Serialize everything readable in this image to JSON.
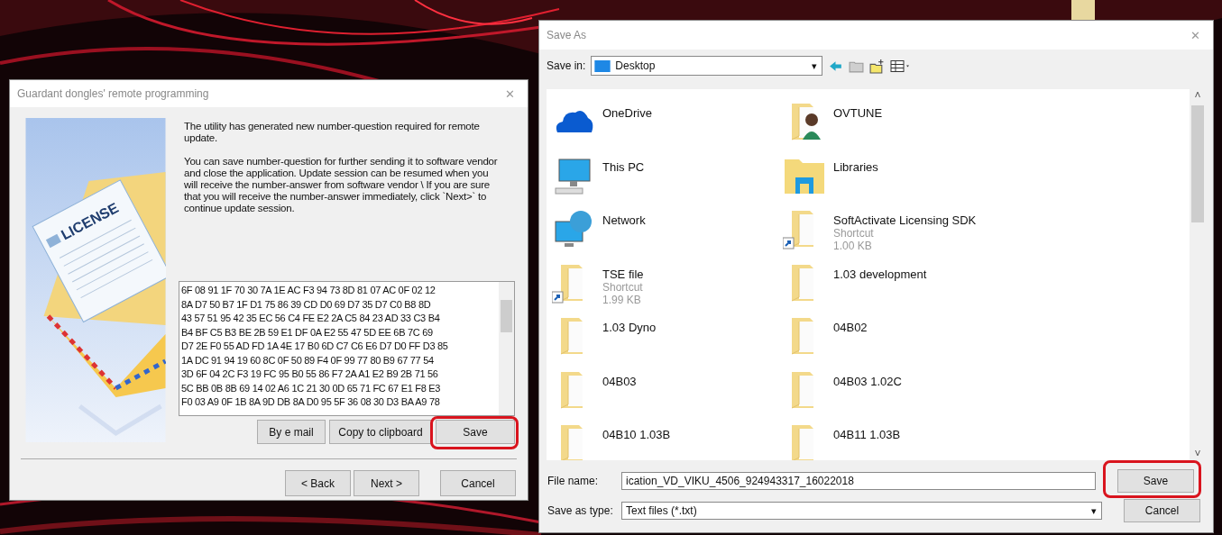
{
  "wizard": {
    "title": "Guardant dongles' remote programming",
    "close": "✕",
    "illustration_text": "LICENSE",
    "paragraphs": [
      "The utility has generated new number-question required for remote update.",
      " You can save number-question for further sending it to software vendor and close the application. Update session can be resumed when you will receive the number-answer from software vendor \\ If you are sure that you will receive the number-answer immediately, click `Next>` to continue update session."
    ],
    "hex_lines": [
      "6F 08 91 1F 70 30 7A 1E AC F3 94 73 8D 81 07 AC 0F 02 12",
      "8A D7 50 B7 1F D1 75 86 39 CD D0 69 D7 35 D7 C0 B8 8D",
      "43 57 51 95 42 35 EC 56 C4 FE E2 2A C5 84 23 AD 33 C3 B4",
      "B4 BF C5 B3 BE 2B 59 E1 DF 0A E2 55 47 5D EE 6B 7C 69",
      "D7 2E F0 55 AD FD 1A 4E 17 B0 6D C7 C6 E6 D7 D0 FF D3 85",
      "1A DC 91 94 19 60 8C 0F 50 89 F4 0F 99 77 80 B9 67 77 54",
      "3D 6F 04 2C F3 19 FC 95 B0 55 86 F7 2A A1 E2 B9 2B 71 56",
      "5C BB 0B 8B 69 14 02 A6 1C 21 30 0D 65 71 FC 67 E1 F8 E3",
      "F0 03 A9 0F 1B 8A 9D DB 8A D0 95 5F 36 08 30 D3 BA A9 78"
    ],
    "actions": [
      {
        "label": "By e mail",
        "highlighted": false
      },
      {
        "label": "Copy to clipboard",
        "highlighted": false
      },
      {
        "label": "Save",
        "highlighted": true
      }
    ],
    "nav": [
      {
        "label": "< Back"
      },
      {
        "label": "Next >"
      },
      {
        "label": "Cancel"
      }
    ]
  },
  "save_as": {
    "title": "Save As",
    "close": "✕",
    "save_in_label": "Save in:",
    "save_in_value": "Desktop",
    "dropdown_arrow": "▾",
    "scroll_up": "˄",
    "scroll_down": "˅",
    "items": [
      {
        "name": "OneDrive",
        "kind": "cloud",
        "shortcut": false
      },
      {
        "name": "OVTUNE",
        "kind": "user-folder",
        "shortcut": false
      },
      {
        "name": "This PC",
        "kind": "computer",
        "shortcut": false
      },
      {
        "name": "Libraries",
        "kind": "library",
        "shortcut": false
      },
      {
        "name": "Network",
        "kind": "network",
        "shortcut": false
      },
      {
        "name": "SoftActivate Licensing SDK",
        "kind": "folder",
        "shortcut": true,
        "details": [
          "Shortcut",
          "1.00 KB"
        ]
      },
      {
        "name": "TSE file",
        "kind": "folder",
        "shortcut": true,
        "details": [
          "Shortcut",
          "1.99 KB"
        ]
      },
      {
        "name": "1.03 development",
        "kind": "folder",
        "shortcut": false
      },
      {
        "name": "1.03 Dyno",
        "kind": "folder",
        "shortcut": false
      },
      {
        "name": "04B02",
        "kind": "folder",
        "shortcut": false
      },
      {
        "name": "04B03",
        "kind": "folder",
        "shortcut": false
      },
      {
        "name": "04B03 1.02C",
        "kind": "folder",
        "shortcut": false
      },
      {
        "name": "04B10 1.03B",
        "kind": "folder",
        "shortcut": false
      },
      {
        "name": "04B11 1.03B",
        "kind": "folder",
        "shortcut": false
      }
    ],
    "file_name_label": "File name:",
    "file_name": "ication_VD_VIKU_4506_924943317_16022018",
    "type_label": "Save as type:",
    "type_value": "Text files (*.txt)",
    "save": {
      "label": "Save",
      "highlighted": true
    },
    "cancel": {
      "label": "Cancel"
    }
  }
}
